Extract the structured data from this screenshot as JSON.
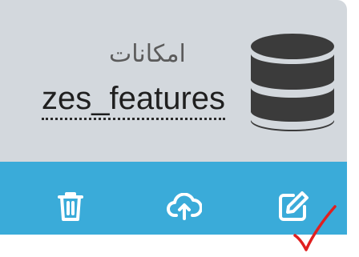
{
  "card": {
    "subtitle": "امکانات",
    "title": "zes_features",
    "icon": "database-icon"
  },
  "actions": {
    "delete_icon": "trash-icon",
    "upload_icon": "cloud-upload-icon",
    "edit_icon": "edit-icon"
  },
  "annotation": {
    "mark": "red-checkmark"
  },
  "colors": {
    "card_top_bg": "#d3d8dd",
    "card_bottom_bg": "#3aabd9",
    "icon_dark": "#3b3b3b",
    "check_red": "#e02020"
  }
}
